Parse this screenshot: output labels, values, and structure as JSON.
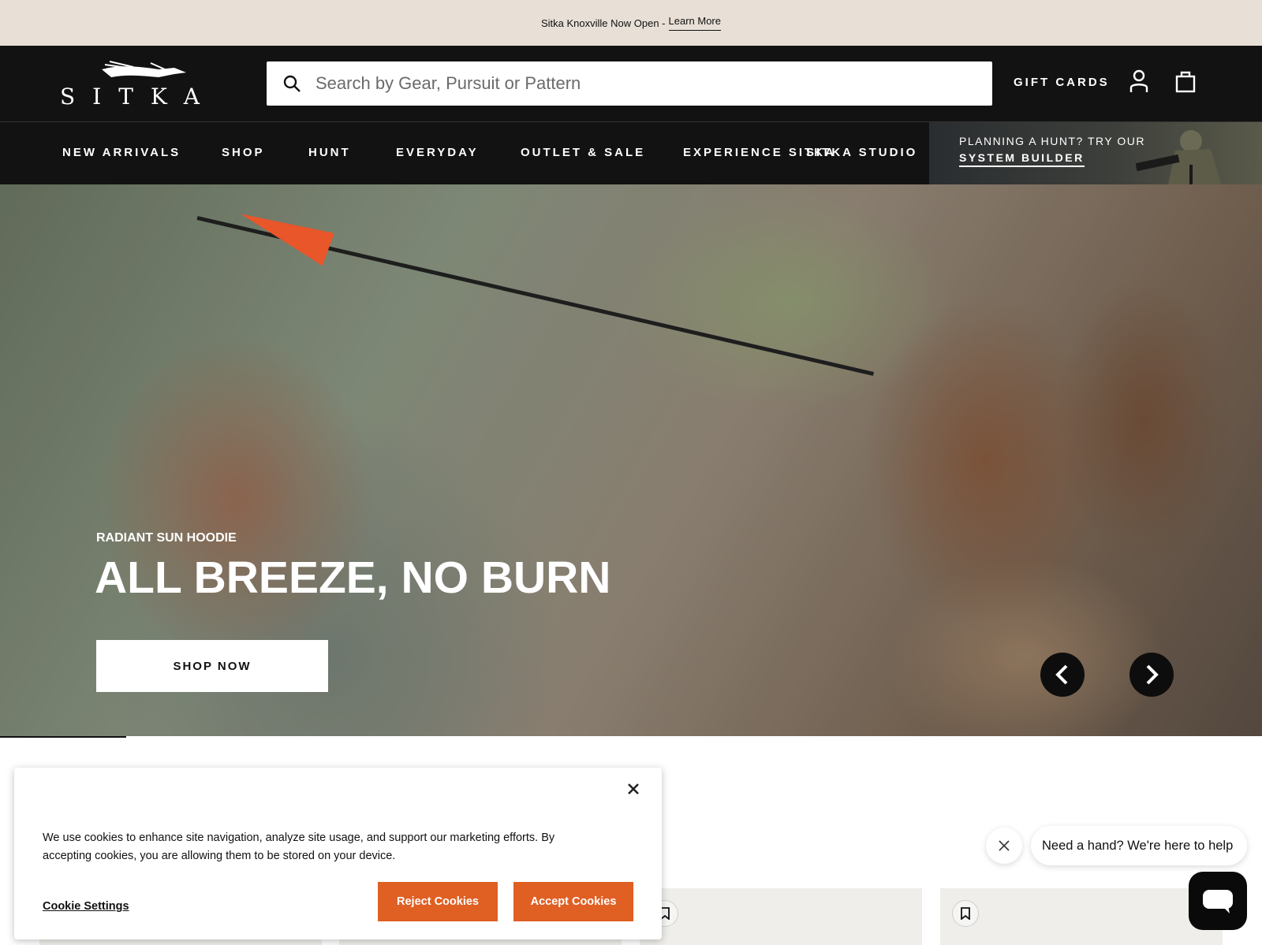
{
  "announcement": {
    "text": "Sitka Knoxville Now Open -",
    "link": "Learn More"
  },
  "header": {
    "logo_text": "SITKA",
    "search_placeholder": "Search by Gear, Pursuit or Pattern",
    "gift_cards": "GIFT CARDS"
  },
  "nav": {
    "items": [
      "NEW ARRIVALS",
      "SHOP",
      "HUNT",
      "EVERYDAY",
      "OUTLET & SALE",
      "EXPERIENCE SITKA",
      "SITKA STUDIO"
    ],
    "promo_line1": "PLANNING A HUNT? TRY OUR",
    "promo_line2": "SYSTEM BUILDER"
  },
  "hero": {
    "eyebrow": "RADIANT SUN HOODIE",
    "title": "ALL BREEZE, NO BURN",
    "cta": "SHOP NOW"
  },
  "cookie": {
    "text": "We use cookies to enhance site navigation, analyze site usage, and support our marketing efforts. By accepting cookies, you are allowing them to be stored on your device.",
    "settings": "Cookie Settings",
    "reject": "Reject Cookies",
    "accept": "Accept Cookies"
  },
  "chat": {
    "message": "Need a hand? We're here to help"
  },
  "colors": {
    "accent_orange": "#e05f23",
    "header_bg": "#121212",
    "announce_bg": "#e8e0d6"
  }
}
